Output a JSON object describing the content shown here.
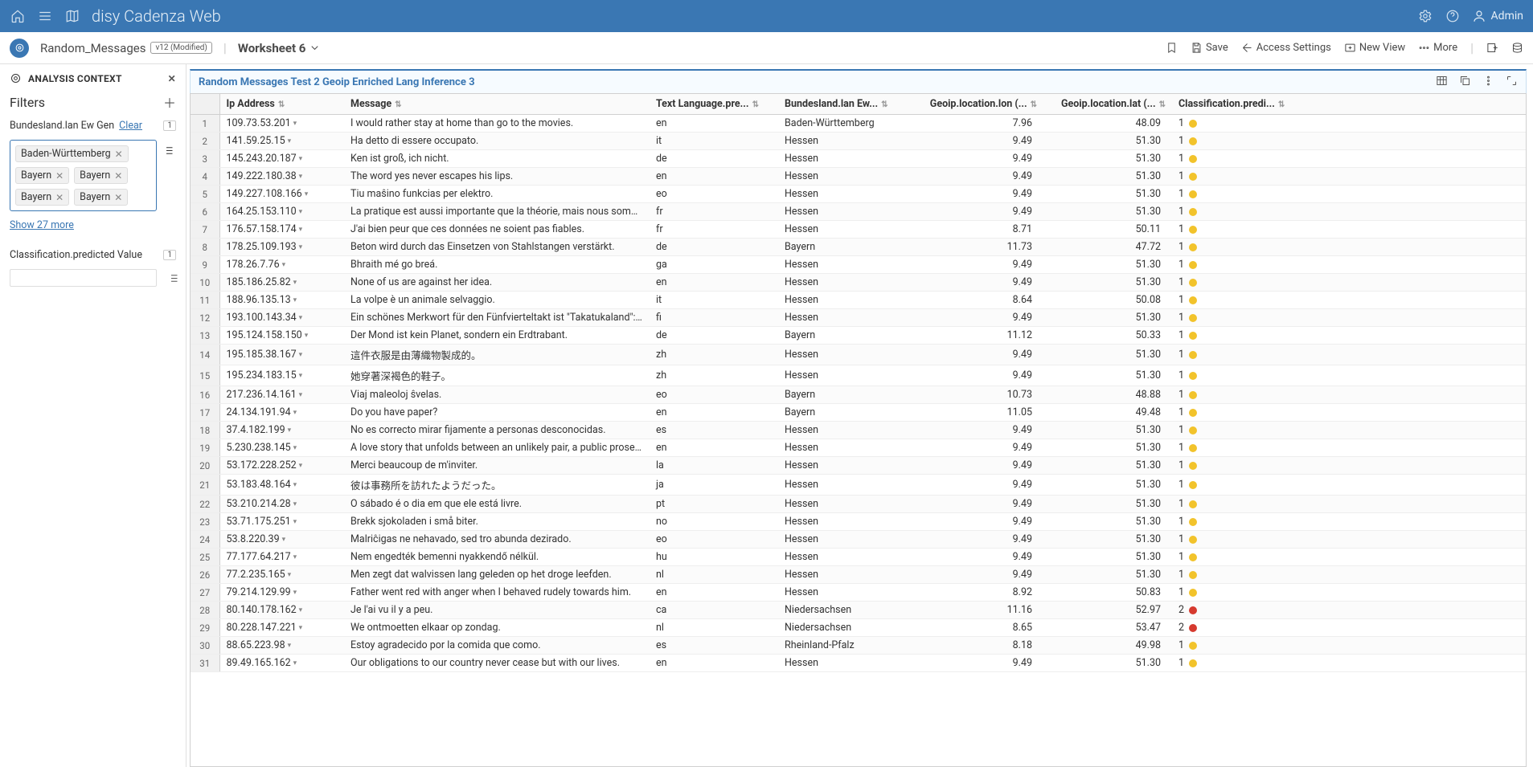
{
  "topbar": {
    "title": "disy Cadenza Web",
    "user": "Admin"
  },
  "toolbar": {
    "doc_name": "Random_Messages",
    "badge": "v12 (Modified)",
    "worksheet": "Worksheet 6",
    "save": "Save",
    "access": "Access Settings",
    "newview": "New View",
    "more": "More"
  },
  "sidebar": {
    "panel_title": "ANALYSIS CONTEXT",
    "filters_title": "Filters",
    "filter1_label": "Bundesland.lan Ew Gen",
    "clear": "Clear",
    "filter1_count": "1",
    "tags": [
      "Baden-Württemberg",
      "Bayern",
      "Bayern",
      "Bayern",
      "Bayern"
    ],
    "showmore": "Show 27 more",
    "filter2_label": "Classification.predicted Value",
    "filter2_count": "1"
  },
  "sheet": {
    "title": "Random Messages Test 2 Geoip Enriched Lang Inference 3",
    "columns": [
      "Ip Address",
      "Message",
      "Text Language.pre...",
      "Bundesland.lan Ew...",
      "Geoip.location.lon (...",
      "Geoip.location.lat (...",
      "Classification.predi..."
    ],
    "rows": [
      {
        "n": 1,
        "ip": "109.73.53.201",
        "msg": "I would rather stay at home than go to the movies.",
        "lang": "en",
        "bund": "Baden-Württemberg",
        "lon": "7.96",
        "lat": "48.09",
        "pred": "1",
        "dot": "yellow"
      },
      {
        "n": 2,
        "ip": "141.59.25.15",
        "msg": "Ha detto di essere occupato.",
        "lang": "it",
        "bund": "Hessen",
        "lon": "9.49",
        "lat": "51.30",
        "pred": "1",
        "dot": "yellow"
      },
      {
        "n": 3,
        "ip": "145.243.20.187",
        "msg": "Ken ist groß, ich nicht.",
        "lang": "de",
        "bund": "Hessen",
        "lon": "9.49",
        "lat": "51.30",
        "pred": "1",
        "dot": "yellow"
      },
      {
        "n": 4,
        "ip": "149.222.180.38",
        "msg": "The word yes never escapes his lips.",
        "lang": "en",
        "bund": "Hessen",
        "lon": "9.49",
        "lat": "51.30",
        "pred": "1",
        "dot": "yellow"
      },
      {
        "n": 5,
        "ip": "149.227.108.166",
        "msg": "Tiu maŝino funkcias per elektro.",
        "lang": "eo",
        "bund": "Hessen",
        "lon": "9.49",
        "lat": "51.30",
        "pred": "1",
        "dot": "yellow"
      },
      {
        "n": 6,
        "ip": "164.25.153.110",
        "msg": "La pratique est aussi importante que la théorie, mais nous sommes e...",
        "lang": "fr",
        "bund": "Hessen",
        "lon": "9.49",
        "lat": "51.30",
        "pred": "1",
        "dot": "yellow"
      },
      {
        "n": 7,
        "ip": "176.57.158.174",
        "msg": "J'ai bien peur que ces données ne soient pas fiables.",
        "lang": "fr",
        "bund": "Hessen",
        "lon": "8.71",
        "lat": "50.11",
        "pred": "1",
        "dot": "yellow"
      },
      {
        "n": 8,
        "ip": "178.25.109.193",
        "msg": "Beton wird durch das Einsetzen von Stahlstangen verstärkt.",
        "lang": "de",
        "bund": "Bayern",
        "lon": "11.73",
        "lat": "47.72",
        "pred": "1",
        "dot": "yellow"
      },
      {
        "n": 9,
        "ip": "178.26.7.76",
        "msg": "Bhraith mé go breá.",
        "lang": "ga",
        "bund": "Hessen",
        "lon": "9.49",
        "lat": "51.30",
        "pred": "1",
        "dot": "yellow"
      },
      {
        "n": 10,
        "ip": "185.186.25.82",
        "msg": "None of us are against her idea.",
        "lang": "en",
        "bund": "Hessen",
        "lon": "9.49",
        "lat": "51.30",
        "pred": "1",
        "dot": "yellow"
      },
      {
        "n": 11,
        "ip": "188.96.135.13",
        "msg": "La volpe è un animale selvaggio.",
        "lang": "it",
        "bund": "Hessen",
        "lon": "8.64",
        "lat": "50.08",
        "pred": "1",
        "dot": "yellow"
      },
      {
        "n": 12,
        "ip": "193.100.143.34",
        "msg": "Ein schönes Merkwort für den Fünfvierteltakt ist \"Takatukaland\": Taka...",
        "lang": "fi",
        "bund": "Hessen",
        "lon": "9.49",
        "lat": "51.30",
        "pred": "1",
        "dot": "yellow"
      },
      {
        "n": 13,
        "ip": "195.124.158.150",
        "msg": "Der Mond ist kein Planet, sondern ein Erdtrabant.",
        "lang": "de",
        "bund": "Bayern",
        "lon": "11.12",
        "lat": "50.33",
        "pred": "1",
        "dot": "yellow"
      },
      {
        "n": 14,
        "ip": "195.185.38.167",
        "msg": "這件衣服是由薄織物製成的。",
        "lang": "zh",
        "bund": "Hessen",
        "lon": "9.49",
        "lat": "51.30",
        "pred": "1",
        "dot": "yellow"
      },
      {
        "n": 15,
        "ip": "195.234.183.15",
        "msg": "她穿著深褐色的鞋子。",
        "lang": "zh",
        "bund": "Hessen",
        "lon": "9.49",
        "lat": "51.30",
        "pred": "1",
        "dot": "yellow"
      },
      {
        "n": 16,
        "ip": "217.236.14.161",
        "msg": "Viaj maleoloj ŝvelas.",
        "lang": "eo",
        "bund": "Bayern",
        "lon": "10.73",
        "lat": "48.88",
        "pred": "1",
        "dot": "yellow"
      },
      {
        "n": 17,
        "ip": "24.134.191.94",
        "msg": "Do you have paper?",
        "lang": "en",
        "bund": "Bayern",
        "lon": "11.05",
        "lat": "49.48",
        "pred": "1",
        "dot": "yellow"
      },
      {
        "n": 18,
        "ip": "37.4.182.199",
        "msg": "No es correcto mirar fijamente a personas desconocidas.",
        "lang": "es",
        "bund": "Hessen",
        "lon": "9.49",
        "lat": "51.30",
        "pred": "1",
        "dot": "yellow"
      },
      {
        "n": 19,
        "ip": "5.230.238.145",
        "msg": "A love story that unfolds between an unlikely pair, a public prosecutor...",
        "lang": "en",
        "bund": "Hessen",
        "lon": "9.49",
        "lat": "51.30",
        "pred": "1",
        "dot": "yellow"
      },
      {
        "n": 20,
        "ip": "53.172.228.252",
        "msg": "Merci beaucoup de m'inviter.",
        "lang": "la",
        "bund": "Hessen",
        "lon": "9.49",
        "lat": "51.30",
        "pred": "1",
        "dot": "yellow"
      },
      {
        "n": 21,
        "ip": "53.183.48.164",
        "msg": "彼は事務所を訪れたようだった。",
        "lang": "ja",
        "bund": "Hessen",
        "lon": "9.49",
        "lat": "51.30",
        "pred": "1",
        "dot": "yellow"
      },
      {
        "n": 22,
        "ip": "53.210.214.28",
        "msg": "O sábado é o dia em que ele está livre.",
        "lang": "pt",
        "bund": "Hessen",
        "lon": "9.49",
        "lat": "51.30",
        "pred": "1",
        "dot": "yellow"
      },
      {
        "n": 23,
        "ip": "53.71.175.251",
        "msg": "Brekk sjokoladen i små biter.",
        "lang": "no",
        "bund": "Hessen",
        "lon": "9.49",
        "lat": "51.30",
        "pred": "1",
        "dot": "yellow"
      },
      {
        "n": 24,
        "ip": "53.8.220.39",
        "msg": "Malriĉigas ne nehavado, sed tro abunda dezirado.",
        "lang": "eo",
        "bund": "Hessen",
        "lon": "9.49",
        "lat": "51.30",
        "pred": "1",
        "dot": "yellow"
      },
      {
        "n": 25,
        "ip": "77.177.64.217",
        "msg": "Nem engedték bemenni nyakkendő nélkül.",
        "lang": "hu",
        "bund": "Hessen",
        "lon": "9.49",
        "lat": "51.30",
        "pred": "1",
        "dot": "yellow"
      },
      {
        "n": 26,
        "ip": "77.2.235.165",
        "msg": "Men zegt dat walvissen lang geleden op het droge leefden.",
        "lang": "nl",
        "bund": "Hessen",
        "lon": "9.49",
        "lat": "51.30",
        "pred": "1",
        "dot": "yellow"
      },
      {
        "n": 27,
        "ip": "79.214.129.99",
        "msg": "Father went red with anger when I behaved rudely towards him.",
        "lang": "en",
        "bund": "Hessen",
        "lon": "8.92",
        "lat": "50.83",
        "pred": "1",
        "dot": "yellow"
      },
      {
        "n": 28,
        "ip": "80.140.178.162",
        "msg": "Je l'ai vu il y a peu.",
        "lang": "ca",
        "bund": "Niedersachsen",
        "lon": "11.16",
        "lat": "52.97",
        "pred": "2",
        "dot": "red"
      },
      {
        "n": 29,
        "ip": "80.228.147.221",
        "msg": "We ontmoetten elkaar op zondag.",
        "lang": "nl",
        "bund": "Niedersachsen",
        "lon": "8.65",
        "lat": "53.47",
        "pred": "2",
        "dot": "red"
      },
      {
        "n": 30,
        "ip": "88.65.223.98",
        "msg": "Estoy agradecido por la comida que como.",
        "lang": "es",
        "bund": "Rheinland-Pfalz",
        "lon": "8.18",
        "lat": "49.98",
        "pred": "1",
        "dot": "yellow"
      },
      {
        "n": 31,
        "ip": "89.49.165.162",
        "msg": "Our obligations to our country never cease but with our lives.",
        "lang": "en",
        "bund": "Hessen",
        "lon": "9.49",
        "lat": "51.30",
        "pred": "1",
        "dot": "yellow"
      }
    ]
  }
}
